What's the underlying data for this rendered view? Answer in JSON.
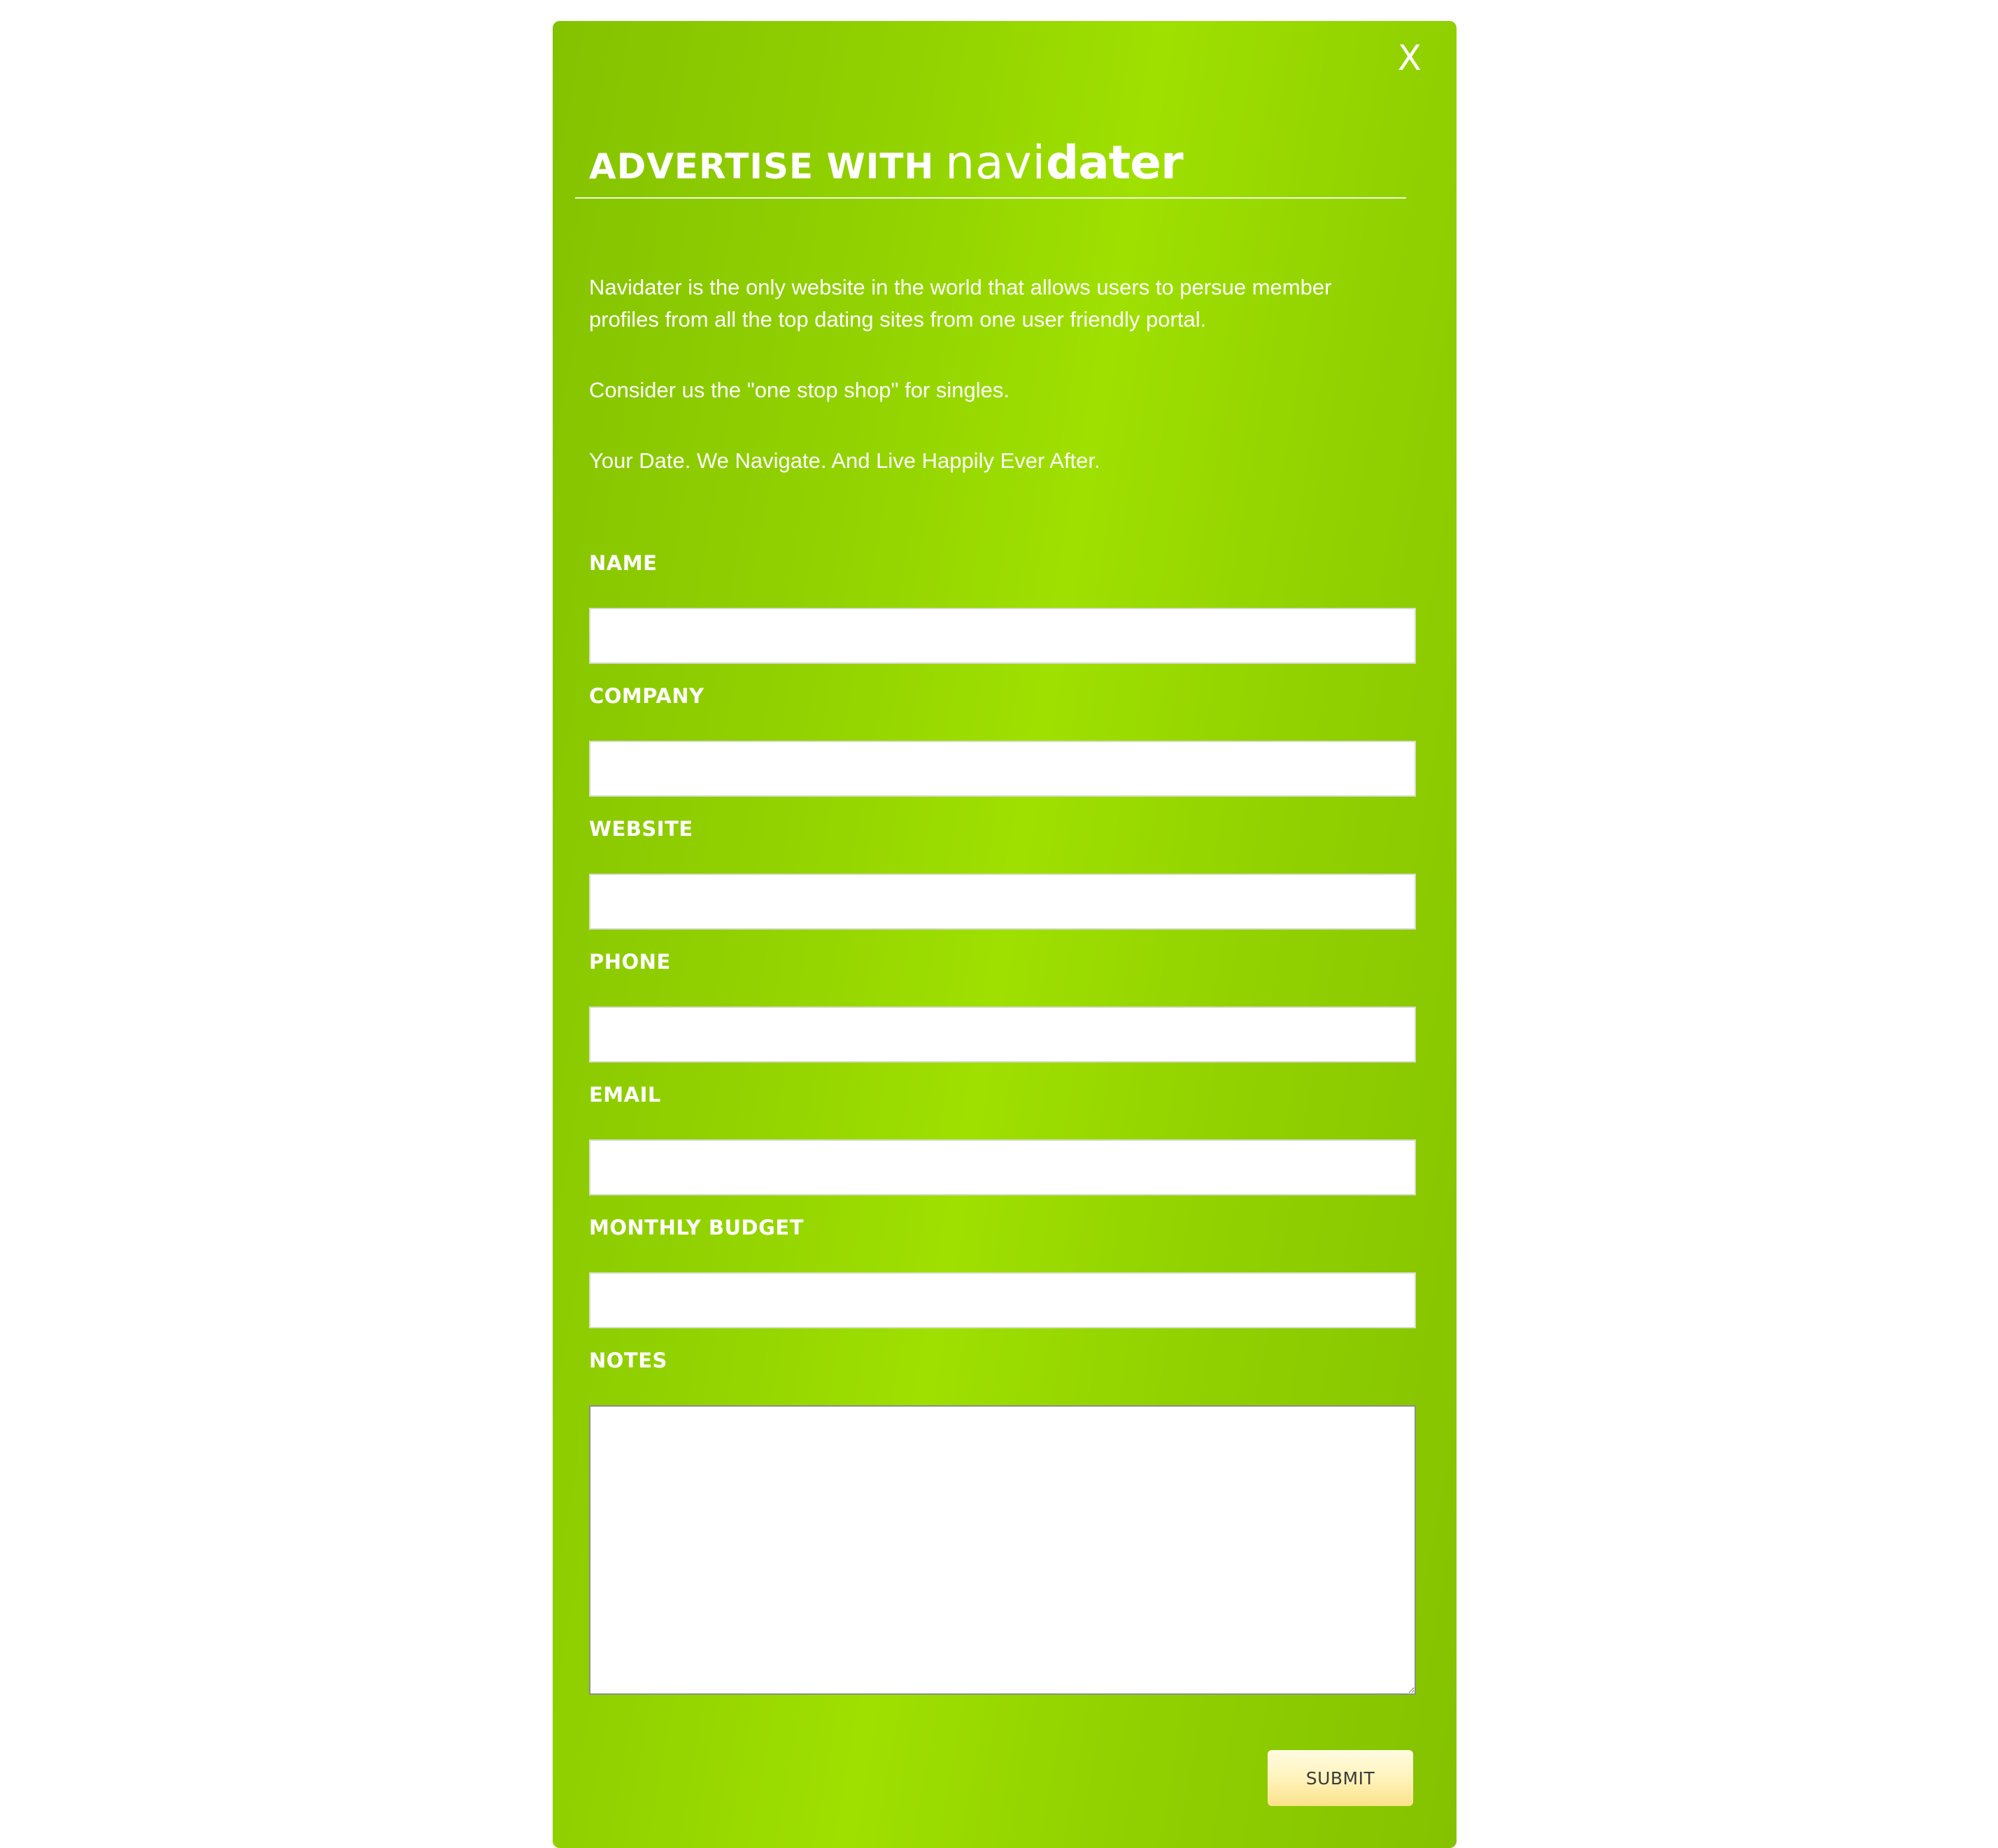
{
  "modal": {
    "close_label": "X",
    "title_prefix": "ADVERTISE WITH",
    "logo_light": "navi",
    "logo_bold": "dater",
    "intro": [
      "Navidater is the only website in the world that allows users to persue member profiles from all the top dating sites from one user friendly portal.",
      "Consider us the \"one stop shop\" for singles.",
      "Your Date. We Navigate. And Live Happily Ever After."
    ]
  },
  "form": {
    "name": {
      "label": "NAME",
      "value": ""
    },
    "company": {
      "label": "COMPANY",
      "value": ""
    },
    "website": {
      "label": "WEBSITE",
      "value": ""
    },
    "phone": {
      "label": "PHONE",
      "value": ""
    },
    "email": {
      "label": "EMAIL",
      "value": ""
    },
    "budget": {
      "label": "MONTHLY BUDGET",
      "value": ""
    },
    "notes": {
      "label": "NOTES",
      "value": ""
    },
    "submit_label": "SUBMIT"
  },
  "colors": {
    "accent_green": "#9fe000",
    "submit_yellow": "#fff2b8"
  },
  "icons": {
    "close": "close-icon"
  }
}
